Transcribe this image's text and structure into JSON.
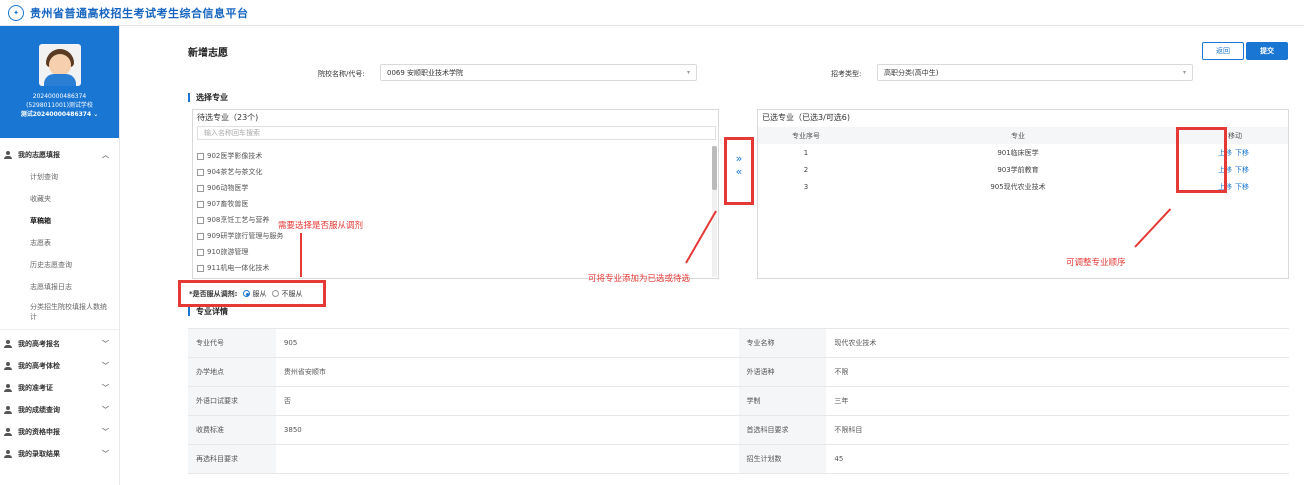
{
  "header": {
    "logo_icon": "graduation-logo-icon",
    "title": "贵州省普通高校招生考试考生综合信息平台"
  },
  "profile": {
    "id_line": "20240000486374",
    "school_line": "(5298011001)测试学校",
    "name_line": "测试20240000486374 ⌄"
  },
  "menu": {
    "group1": {
      "label": "我的志愿填报",
      "expanded": true
    },
    "group1_items": [
      {
        "label": "计划查询"
      },
      {
        "label": "收藏夹"
      },
      {
        "label": "草稿箱",
        "active": true
      },
      {
        "label": "志愿表"
      },
      {
        "label": "历史志愿查询"
      },
      {
        "label": "志愿填报日志"
      },
      {
        "label": "分类招生院校填报人数统计"
      }
    ],
    "groups": [
      {
        "label": "我的高考报名"
      },
      {
        "label": "我的高考体检"
      },
      {
        "label": "我的准考证"
      },
      {
        "label": "我的成绩查询"
      },
      {
        "label": "我的资格申报"
      },
      {
        "label": "我的录取结果"
      }
    ]
  },
  "page": {
    "title": "新增志愿",
    "back_label": "返回",
    "submit_label": "提交",
    "school_label": "院校名称/代号:",
    "school_value": "0069 安顺职业技术学院",
    "type_label": "招考类型:",
    "type_value": "高职分类(高中生)",
    "select_major_title": "选择专业",
    "detail_title": "专业详情"
  },
  "pending": {
    "title": "待选专业（23个)",
    "search_placeholder": "输入名称回车搜索",
    "items": [
      "902医学影像技术",
      "904茶艺与茶文化",
      "906动物医学",
      "907畜牧兽医",
      "908烹饪工艺与营养",
      "909研学旅行管理与服务",
      "910旅游管理",
      "911机电一体化技术"
    ]
  },
  "transfer": {
    "add_symbol": "»",
    "remove_symbol": "«"
  },
  "selected": {
    "title": "已选专业（已选3/可选6)",
    "headers": [
      "专业序号",
      "专业",
      "移动"
    ],
    "rows": [
      {
        "seq": "1",
        "major": "901临床医学",
        "up": "上移",
        "down": "下移"
      },
      {
        "seq": "2",
        "major": "903学前教育",
        "up": "上移",
        "down": "下移"
      },
      {
        "seq": "3",
        "major": "905现代农业技术",
        "up": "上移",
        "down": "下移"
      }
    ]
  },
  "annotations": {
    "obey_hint": "需要选择是否服从调剂",
    "transfer_hint": "可将专业添加为已选或待选",
    "order_hint": "可调整专业顺序",
    "color": "#e53935"
  },
  "obey": {
    "label": "*是否服从调剂:",
    "option_yes": "服从",
    "option_no": "不服从",
    "selected": "服从"
  },
  "detail": {
    "rows": [
      [
        {
          "label": "专业代号",
          "value": "905"
        },
        {
          "label": "专业名称",
          "value": "现代农业技术"
        }
      ],
      [
        {
          "label": "办学地点",
          "value": "贵州省安顺市"
        },
        {
          "label": "外语语种",
          "value": "不限"
        }
      ],
      [
        {
          "label": "外语口试要求",
          "value": "否"
        },
        {
          "label": "学制",
          "value": "三年"
        }
      ],
      [
        {
          "label": "收费标准",
          "value": "3850"
        },
        {
          "label": "首选科目要求",
          "value": "不限科目"
        }
      ],
      [
        {
          "label": "再选科目要求",
          "value": ""
        },
        {
          "label": "招生计划数",
          "value": "45"
        }
      ]
    ]
  },
  "colors": {
    "primary": "#1976d2",
    "annotation": "#e53935"
  }
}
